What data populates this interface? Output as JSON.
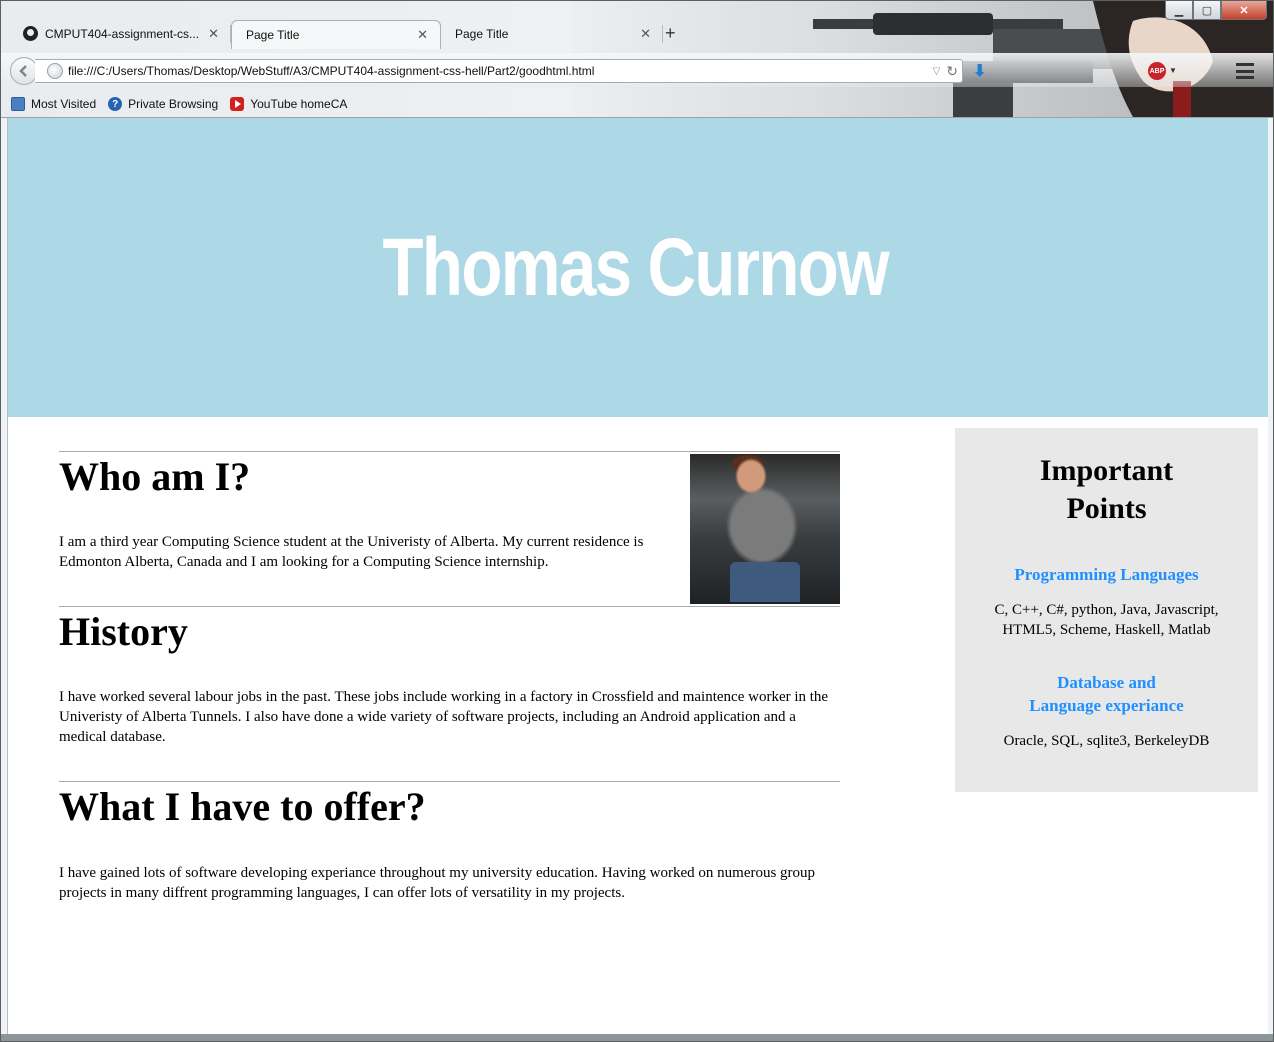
{
  "window": {
    "controls": {
      "minimize": "▁",
      "maximize": "▢",
      "close": "✕"
    }
  },
  "tabs": [
    {
      "title": "CMPUT404-assignment-cs...",
      "icon": "github-icon",
      "close": "✕"
    },
    {
      "title": "Page Title",
      "close": "✕"
    },
    {
      "title": "Page Title",
      "close": "✕"
    }
  ],
  "new_tab": "+",
  "url": "file:///C:/Users/Thomas/Desktop/WebStuff/A3/CMPUT404-assignment-css-hell/Part2/goodhtml.html",
  "bookmarks": [
    {
      "label": "Most Visited",
      "icon": "most-visited-icon"
    },
    {
      "label": "Private Browsing",
      "icon": "help-icon"
    },
    {
      "label": "YouTube homeCA",
      "icon": "youtube-icon"
    }
  ],
  "addon": {
    "abp": "ABP"
  },
  "page": {
    "hero_title": "Thomas Curnow",
    "sections": [
      {
        "heading": "Who am I?",
        "body": "I am a third year Computing Science student at the Univeristy of Alberta. My current residence is Edmonton Alberta, Canada and I am looking for a Computing Science internship."
      },
      {
        "heading": "History",
        "body": "I have worked several labour jobs in the past. These jobs include working in a factory in Crossfield and maintence worker in the Univeristy of Alberta Tunnels. I also have done a wide variety of software projects, including an Android application and a medical database."
      },
      {
        "heading": "What I have to offer?",
        "body": "I have gained lots of software developing experiance throughout my university education. Having worked on numerous group projects in many diffrent programming languages, I can offer lots of versatility in my projects."
      }
    ],
    "aside": {
      "title_line1": "Important",
      "title_line2": "Points",
      "lang_heading": "Programming Languages",
      "lang_body_line1": "C, C++, C#, python, Java, Javascript,",
      "lang_body_line2": "HTML5, Scheme, Haskell, Matlab",
      "db_heading_line1": "Database and",
      "db_heading_line2": "Language experiance",
      "db_body": "Oracle, SQL, sqlite3, BerkeleyDB"
    }
  },
  "colors": {
    "hero_bg": "#add8e6",
    "aside_bg": "#e8e8e8",
    "accent": "#1e90ff"
  }
}
